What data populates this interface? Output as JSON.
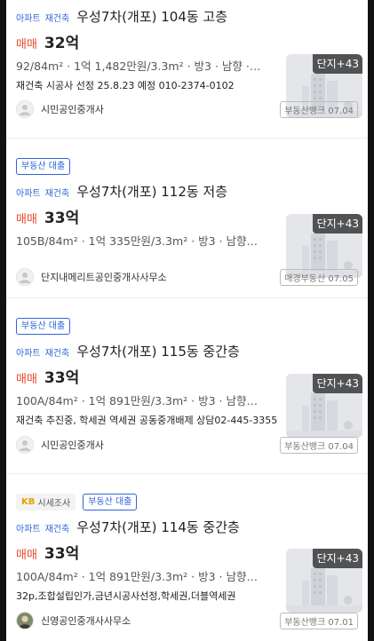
{
  "listings": [
    {
      "badges": [],
      "type": "아파트",
      "rebuild": "재건축",
      "title": "우성7차(개포) 104동 고층",
      "deal": "매매",
      "price": "32억",
      "info": "92/84m² · 1억 1,482만원/3.3m² · 방3 · 남향 · 총…",
      "desc": "재건축 시공사 선정 25.8.23 예정 010-2374-0102",
      "agent": "시민공인중개사",
      "source": "부동산뱅크 07.04",
      "thumb_badge": "단지+43"
    },
    {
      "badges": [
        "부동산 대출"
      ],
      "type": "아파트",
      "rebuild": "재건축",
      "title": "우성7차(개포) 112동 저층",
      "deal": "매매",
      "price": "33억",
      "info": "105B/84m² · 1억 335만원/3.3m² · 방3 · 남향…",
      "desc": "",
      "agent": "단지내메리트공인중개사사무소",
      "source": "매경부동산 07.05",
      "thumb_badge": "단지+43"
    },
    {
      "badges": [
        "부동산 대출"
      ],
      "type": "아파트",
      "rebuild": "재건축",
      "title": "우성7차(개포) 115동 중간층",
      "deal": "매매",
      "price": "33억",
      "info": "100A/84m² · 1억 891만원/3.3m² · 방3 · 남향…",
      "desc": "재건축 추진중, 학세권 역세권 공동중개배제 상담02-445-3355",
      "agent": "시민공인중개사",
      "source": "부동산뱅크 07.04",
      "thumb_badge": "단지+43"
    },
    {
      "kb_badge": {
        "kb": "KB",
        "label": "시세조사"
      },
      "badges": [
        "부동산 대출"
      ],
      "type": "아파트",
      "rebuild": "재건축",
      "title": "우성7차(개포) 114동 중간층",
      "deal": "매매",
      "price": "33억",
      "info": "100A/84m² · 1억 891만원/3.3m² · 방3 · 남향…",
      "desc": "32p,조합설립인가,금년시공사선정,학세권,더블역세권",
      "agent": "신영공인중개사사무소",
      "source": "부동산뱅크 07.01",
      "thumb_badge": "단지+43"
    }
  ]
}
